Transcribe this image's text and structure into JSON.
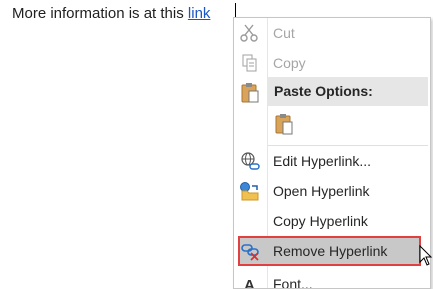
{
  "document": {
    "text_before": "More information is at this ",
    "link_text": "link"
  },
  "context_menu": {
    "cut": "Cut",
    "copy": "Copy",
    "paste_options": "Paste Options:",
    "edit_hyperlink": "Edit Hyperlink...",
    "open_hyperlink": "Open Hyperlink",
    "copy_hyperlink": "Copy Hyperlink",
    "remove_hyperlink": "Remove Hyperlink",
    "font_partial": "Font..."
  },
  "icons": {
    "cut": "scissors-icon",
    "copy": "copy-icon",
    "paste": "clipboard-icon",
    "paste_keep_text": "clipboard-paste-option-icon",
    "edit_hyperlink": "globe-link-icon",
    "open_hyperlink": "folder-globe-icon",
    "remove_hyperlink": "chain-remove-icon",
    "font": "font-icon"
  },
  "colors": {
    "link": "#1a56c4",
    "highlight_bg": "#c8c8c8",
    "highlight_border": "#e04040",
    "disabled_text": "#a6a6a6"
  }
}
